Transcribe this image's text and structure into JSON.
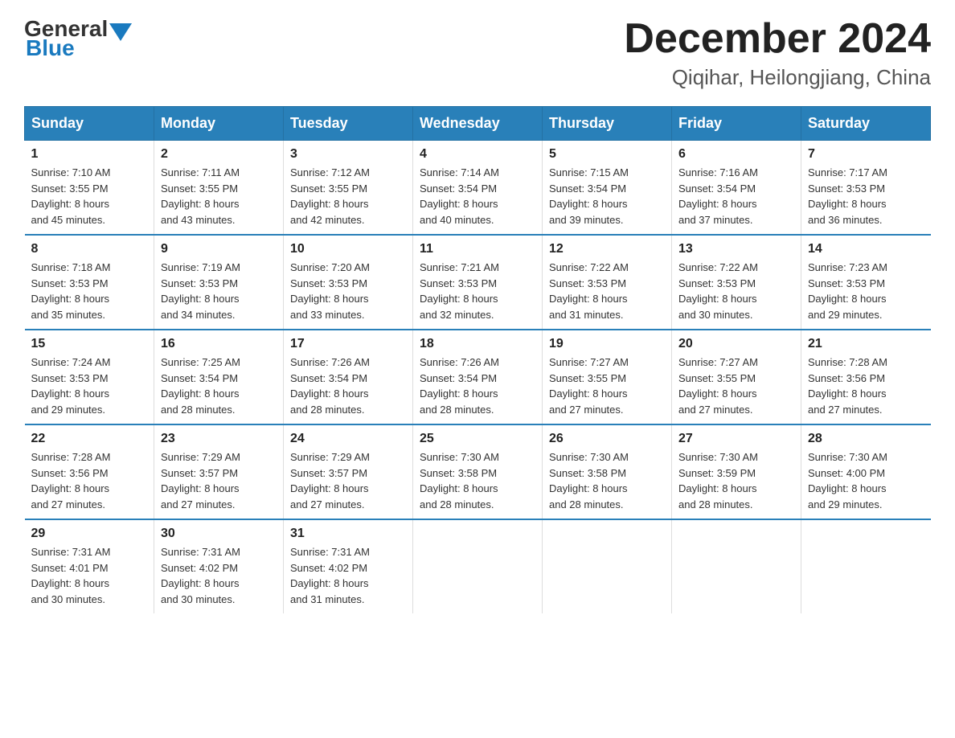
{
  "header": {
    "logo_general": "General",
    "logo_blue": "Blue",
    "month_title": "December 2024",
    "location": "Qiqihar, Heilongjiang, China"
  },
  "weekdays": [
    "Sunday",
    "Monday",
    "Tuesday",
    "Wednesday",
    "Thursday",
    "Friday",
    "Saturday"
  ],
  "weeks": [
    [
      {
        "day": "1",
        "sunrise": "7:10 AM",
        "sunset": "3:55 PM",
        "daylight": "8 hours and 45 minutes."
      },
      {
        "day": "2",
        "sunrise": "7:11 AM",
        "sunset": "3:55 PM",
        "daylight": "8 hours and 43 minutes."
      },
      {
        "day": "3",
        "sunrise": "7:12 AM",
        "sunset": "3:55 PM",
        "daylight": "8 hours and 42 minutes."
      },
      {
        "day": "4",
        "sunrise": "7:14 AM",
        "sunset": "3:54 PM",
        "daylight": "8 hours and 40 minutes."
      },
      {
        "day": "5",
        "sunrise": "7:15 AM",
        "sunset": "3:54 PM",
        "daylight": "8 hours and 39 minutes."
      },
      {
        "day": "6",
        "sunrise": "7:16 AM",
        "sunset": "3:54 PM",
        "daylight": "8 hours and 37 minutes."
      },
      {
        "day": "7",
        "sunrise": "7:17 AM",
        "sunset": "3:53 PM",
        "daylight": "8 hours and 36 minutes."
      }
    ],
    [
      {
        "day": "8",
        "sunrise": "7:18 AM",
        "sunset": "3:53 PM",
        "daylight": "8 hours and 35 minutes."
      },
      {
        "day": "9",
        "sunrise": "7:19 AM",
        "sunset": "3:53 PM",
        "daylight": "8 hours and 34 minutes."
      },
      {
        "day": "10",
        "sunrise": "7:20 AM",
        "sunset": "3:53 PM",
        "daylight": "8 hours and 33 minutes."
      },
      {
        "day": "11",
        "sunrise": "7:21 AM",
        "sunset": "3:53 PM",
        "daylight": "8 hours and 32 minutes."
      },
      {
        "day": "12",
        "sunrise": "7:22 AM",
        "sunset": "3:53 PM",
        "daylight": "8 hours and 31 minutes."
      },
      {
        "day": "13",
        "sunrise": "7:22 AM",
        "sunset": "3:53 PM",
        "daylight": "8 hours and 30 minutes."
      },
      {
        "day": "14",
        "sunrise": "7:23 AM",
        "sunset": "3:53 PM",
        "daylight": "8 hours and 29 minutes."
      }
    ],
    [
      {
        "day": "15",
        "sunrise": "7:24 AM",
        "sunset": "3:53 PM",
        "daylight": "8 hours and 29 minutes."
      },
      {
        "day": "16",
        "sunrise": "7:25 AM",
        "sunset": "3:54 PM",
        "daylight": "8 hours and 28 minutes."
      },
      {
        "day": "17",
        "sunrise": "7:26 AM",
        "sunset": "3:54 PM",
        "daylight": "8 hours and 28 minutes."
      },
      {
        "day": "18",
        "sunrise": "7:26 AM",
        "sunset": "3:54 PM",
        "daylight": "8 hours and 28 minutes."
      },
      {
        "day": "19",
        "sunrise": "7:27 AM",
        "sunset": "3:55 PM",
        "daylight": "8 hours and 27 minutes."
      },
      {
        "day": "20",
        "sunrise": "7:27 AM",
        "sunset": "3:55 PM",
        "daylight": "8 hours and 27 minutes."
      },
      {
        "day": "21",
        "sunrise": "7:28 AM",
        "sunset": "3:56 PM",
        "daylight": "8 hours and 27 minutes."
      }
    ],
    [
      {
        "day": "22",
        "sunrise": "7:28 AM",
        "sunset": "3:56 PM",
        "daylight": "8 hours and 27 minutes."
      },
      {
        "day": "23",
        "sunrise": "7:29 AM",
        "sunset": "3:57 PM",
        "daylight": "8 hours and 27 minutes."
      },
      {
        "day": "24",
        "sunrise": "7:29 AM",
        "sunset": "3:57 PM",
        "daylight": "8 hours and 27 minutes."
      },
      {
        "day": "25",
        "sunrise": "7:30 AM",
        "sunset": "3:58 PM",
        "daylight": "8 hours and 28 minutes."
      },
      {
        "day": "26",
        "sunrise": "7:30 AM",
        "sunset": "3:58 PM",
        "daylight": "8 hours and 28 minutes."
      },
      {
        "day": "27",
        "sunrise": "7:30 AM",
        "sunset": "3:59 PM",
        "daylight": "8 hours and 28 minutes."
      },
      {
        "day": "28",
        "sunrise": "7:30 AM",
        "sunset": "4:00 PM",
        "daylight": "8 hours and 29 minutes."
      }
    ],
    [
      {
        "day": "29",
        "sunrise": "7:31 AM",
        "sunset": "4:01 PM",
        "daylight": "8 hours and 30 minutes."
      },
      {
        "day": "30",
        "sunrise": "7:31 AM",
        "sunset": "4:02 PM",
        "daylight": "8 hours and 30 minutes."
      },
      {
        "day": "31",
        "sunrise": "7:31 AM",
        "sunset": "4:02 PM",
        "daylight": "8 hours and 31 minutes."
      },
      null,
      null,
      null,
      null
    ]
  ]
}
